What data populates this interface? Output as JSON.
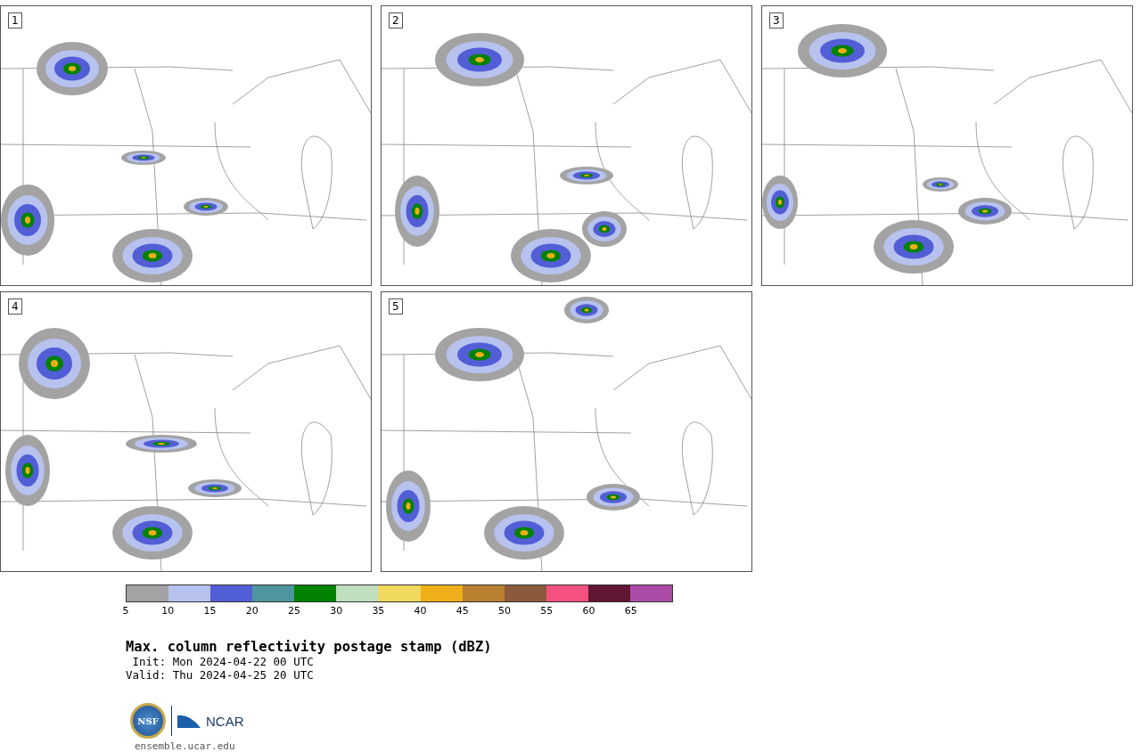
{
  "panels": [
    {
      "label": "1"
    },
    {
      "label": "2"
    },
    {
      "label": "3"
    },
    {
      "label": "4"
    },
    {
      "label": "5"
    }
  ],
  "colorbar": {
    "bins": [
      {
        "color": "#a3a3a3"
      },
      {
        "color": "#b7c2ee"
      },
      {
        "color": "#525ed6"
      },
      {
        "color": "#4e969e"
      },
      {
        "color": "#018200"
      },
      {
        "color": "#bfdfbf"
      },
      {
        "color": "#f0d95c"
      },
      {
        "color": "#efaf19"
      },
      {
        "color": "#b9802f"
      },
      {
        "color": "#8b5a3c"
      },
      {
        "color": "#f5517f"
      },
      {
        "color": "#611633"
      },
      {
        "color": "#ab4ba6"
      }
    ],
    "ticks": [
      "5",
      "10",
      "15",
      "20",
      "25",
      "30",
      "35",
      "40",
      "45",
      "50",
      "55",
      "60",
      "65"
    ]
  },
  "title": "Max. column reflectivity postage stamp (dBZ)",
  "init": " Init: Mon 2024-04-22 00 UTC",
  "valid": "Valid: Thu 2024-04-25 20 UTC",
  "logo": {
    "nsf": "NSF",
    "ncar": "NCAR"
  },
  "url": "ensemble.ucar.edu"
}
